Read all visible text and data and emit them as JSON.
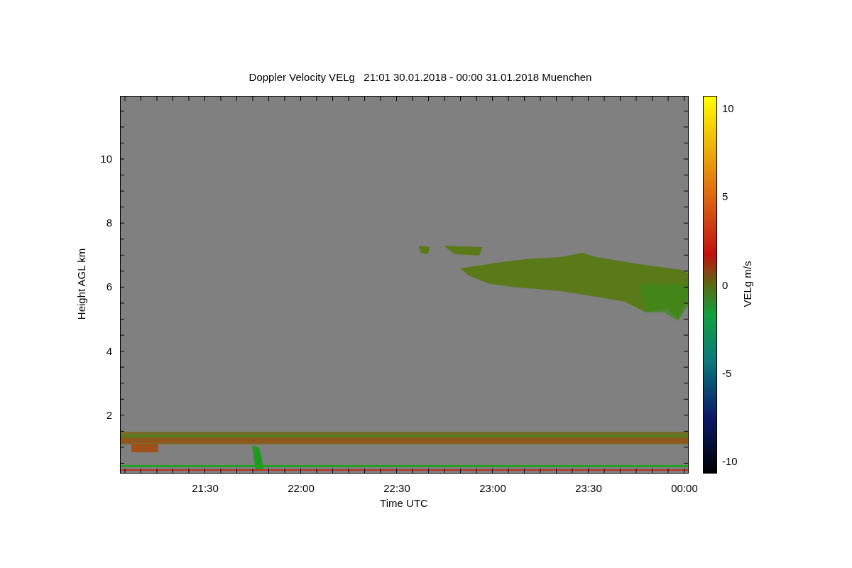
{
  "title": "Doppler Velocity VELg   21:01 30.01.2018 - 00:00 31.01.2018 Muenchen",
  "y_axis": {
    "label": "Height AGL km",
    "ticks": [
      "10",
      "8",
      "6",
      "4",
      "2"
    ]
  },
  "x_axis": {
    "label": "Time UTC",
    "ticks": [
      "21:30",
      "22:00",
      "22:30",
      "23:00",
      "23:30",
      "00:00"
    ]
  },
  "colorbar": {
    "label": "VELg m/s",
    "ticks": [
      "10",
      "5",
      "0",
      "-5",
      "-10"
    ]
  }
}
